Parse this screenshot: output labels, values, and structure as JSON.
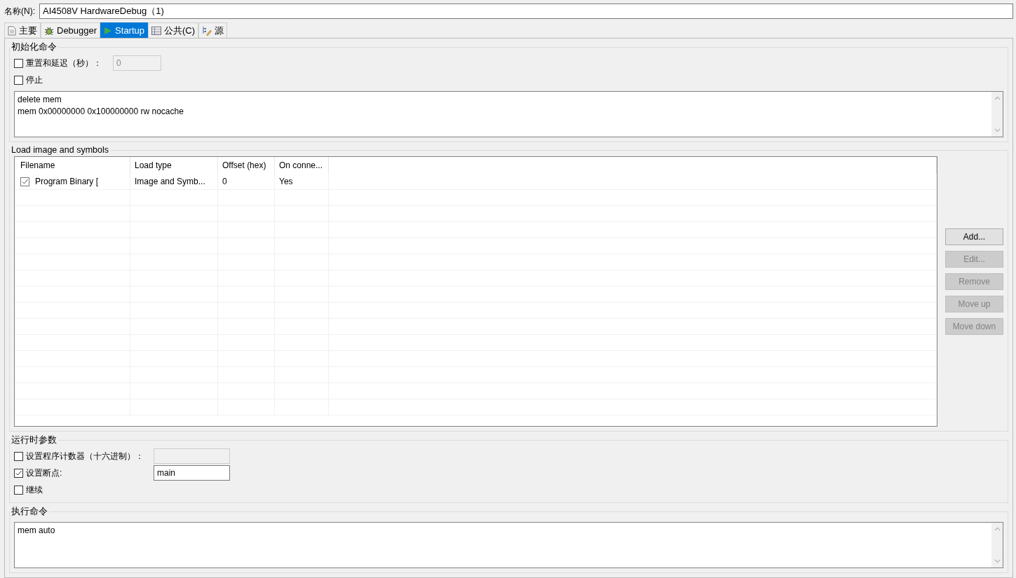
{
  "name_field": {
    "label": "名称(N):",
    "value": "AI4508V HardwareDebug（1)"
  },
  "tabs": [
    {
      "label": "主要",
      "selected": false
    },
    {
      "label": "Debugger",
      "selected": false
    },
    {
      "label": "Startup",
      "selected": true
    },
    {
      "label": "公共(C)",
      "selected": false
    },
    {
      "label": "源",
      "selected": false
    }
  ],
  "init_commands": {
    "title": "初始化命令",
    "reset_delay": {
      "label": "重置和延迟（秒）：",
      "checked": false,
      "value": "0",
      "disabled": true
    },
    "halt": {
      "label": "停止",
      "checked": false
    },
    "commands": [
      "delete mem",
      "mem 0x00000000 0x100000000 rw nocache"
    ]
  },
  "load_image": {
    "title": "Load image and symbols",
    "table": {
      "columns": [
        "Filename",
        "Load type",
        "Offset (hex)",
        "On conne..."
      ],
      "rows": [
        {
          "checked": true,
          "cells": [
            "Program Binary [",
            "Image and Symb...",
            "0",
            "Yes"
          ]
        }
      ]
    },
    "buttons": [
      {
        "label": "Add...",
        "disabled": false
      },
      {
        "label": "Edit...",
        "disabled": true
      },
      {
        "label": "Remove",
        "disabled": true
      },
      {
        "label": "Move up",
        "disabled": true
      },
      {
        "label": "Move down",
        "disabled": true
      }
    ]
  },
  "runtime": {
    "title": "运行时参数",
    "options": [
      {
        "kind": "field",
        "label": "设置程序计数器（十六进制）：",
        "checked": false,
        "disabled": true
      },
      {
        "kind": "field",
        "label": "设置断点:",
        "checked": true,
        "value": "main",
        "disabled": false
      },
      {
        "kind": "plain",
        "label": "继续",
        "checked": false
      }
    ]
  },
  "run_commands": {
    "title": "执行命令",
    "commands": [
      "mem auto"
    ]
  }
}
